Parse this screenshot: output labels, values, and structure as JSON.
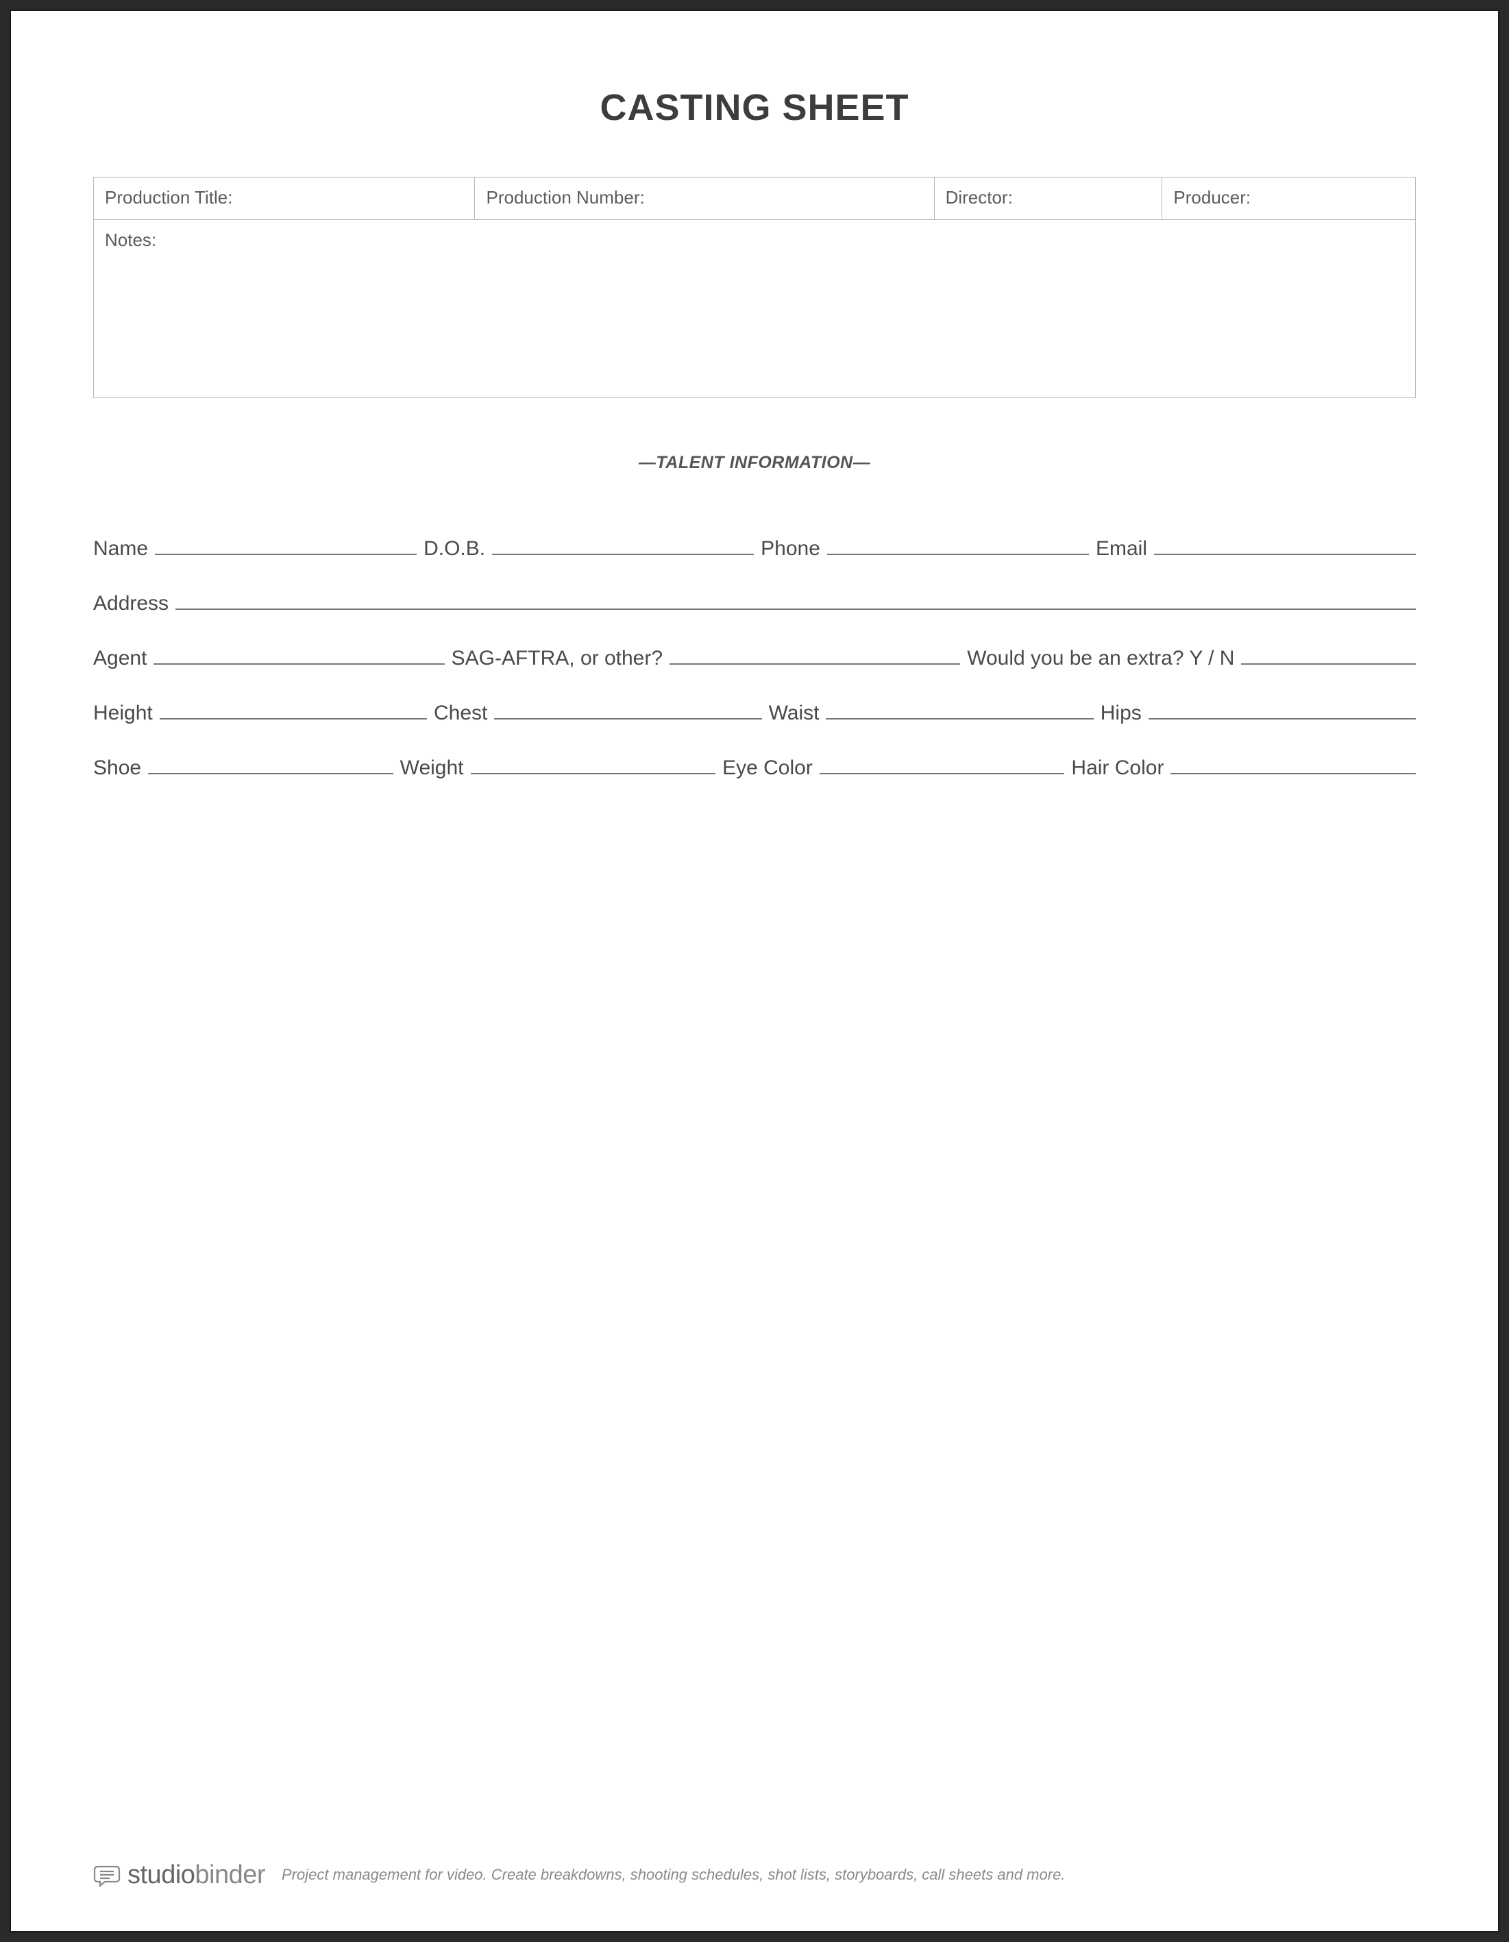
{
  "title": "CASTING SHEET",
  "header": {
    "productionTitle": "Production Title:",
    "productionNumber": "Production Number:",
    "director": "Director:",
    "producer": "Producer:",
    "notes": "Notes:"
  },
  "sectionLabel": "—TALENT INFORMATION—",
  "fields": {
    "name": "Name",
    "dob": "D.O.B.",
    "phone": "Phone",
    "email": "Email",
    "address": "Address",
    "agent": "Agent",
    "union": "SAG-AFTRA, or other?",
    "extra": "Would you be an extra? Y / N",
    "height": "Height",
    "chest": "Chest",
    "waist": "Waist",
    "hips": "Hips",
    "shoe": "Shoe",
    "weight": "Weight",
    "eyeColor": "Eye Color",
    "hairColor": "Hair Color"
  },
  "footer": {
    "brandBold": "studio",
    "brandThin": "binder",
    "tagline": "Project management for video. Create breakdowns, shooting schedules, shot lists, storyboards, call sheets and more."
  }
}
